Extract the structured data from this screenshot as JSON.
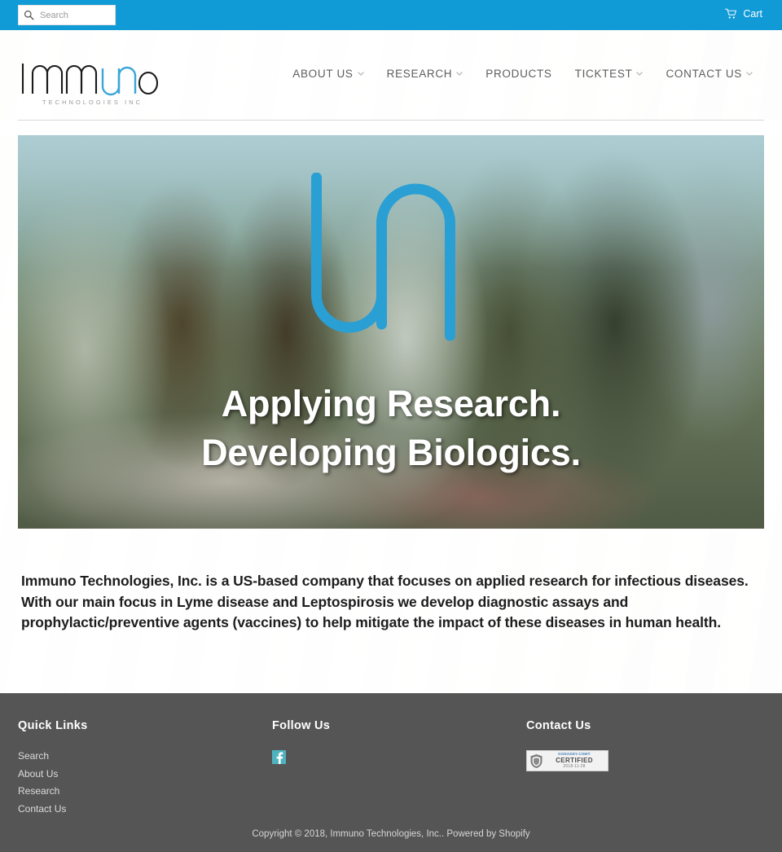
{
  "topbar": {
    "search_placeholder": "Search",
    "search_value": "",
    "cart_label": "Cart"
  },
  "header": {
    "logo_text": "immuno",
    "logo_tagline": "TECHNOLOGIES INC",
    "nav": [
      {
        "label": "ABOUT US",
        "has_dropdown": true
      },
      {
        "label": "RESEARCH",
        "has_dropdown": true
      },
      {
        "label": "PRODUCTS",
        "has_dropdown": false
      },
      {
        "label": "TICKTEST",
        "has_dropdown": true
      },
      {
        "label": "CONTACT US",
        "has_dropdown": true
      }
    ]
  },
  "hero": {
    "line1": "Applying Research.",
    "line2": "Developing Biologics."
  },
  "main": {
    "intro": "Immuno Technologies, Inc. is a US-based company that focuses on applied research for infectious diseases. With our main focus in Lyme disease and Leptospirosis we develop diagnostic assays and prophylactic/preventive agents (vaccines) to help mitigate the impact of these diseases in human health."
  },
  "footer": {
    "quick_links_title": "Quick Links",
    "quick_links": [
      {
        "label": "Search"
      },
      {
        "label": "About Us"
      },
      {
        "label": "Research"
      },
      {
        "label": "Contact Us"
      }
    ],
    "follow_title": "Follow Us",
    "social": [
      {
        "name": "facebook",
        "label": "Facebook"
      }
    ],
    "contact_title": "Contact Us",
    "seal": {
      "brand": "GODADDY.COM®",
      "status": "CERTIFIED",
      "date": "2018-11-28"
    },
    "copyright": "Copyright © 2018, Immuno Technologies, Inc.. Powered by Shopify"
  },
  "colors": {
    "topbar_blue": "#109bd7",
    "logo_blue": "#3aa6d8",
    "footer_gray": "#555555",
    "facebook_teal": "#4fb3bf"
  }
}
